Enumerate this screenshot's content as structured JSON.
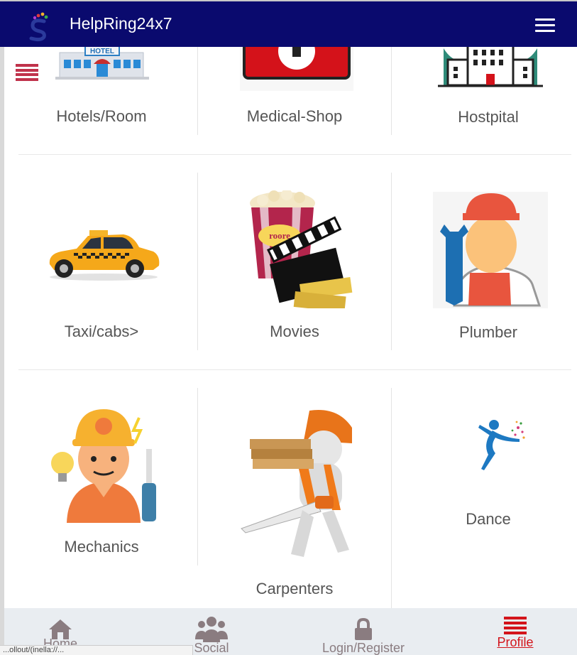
{
  "header": {
    "title": "HelpRing24x7",
    "logo_icon": "colorful-s-logo-icon",
    "menu_icon": "hamburger-icon"
  },
  "side_menu_icon": "list-menu-icon",
  "colors": {
    "header_bg": "#0a0a6e",
    "accent_red": "#d3141b",
    "side_menu": "#c0324b",
    "nav_bg": "#e9edf1"
  },
  "tiles": [
    {
      "label": "Hotels/Room",
      "icon": "hotel-building-icon"
    },
    {
      "label": "Medical-Shop",
      "icon": "medical-sign-icon"
    },
    {
      "label": "Hostpital",
      "icon": "hospital-building-icon"
    },
    {
      "label": "Taxi/cabs>",
      "icon": "taxi-car-icon"
    },
    {
      "label": "Movies",
      "icon": "popcorn-clapperboard-icon"
    },
    {
      "label": "Plumber",
      "icon": "plumber-wrench-icon"
    },
    {
      "label": "Mechanics",
      "icon": "mechanic-worker-icon"
    },
    {
      "label": "Carpenters",
      "icon": "carpenter-saw-icon"
    },
    {
      "label": "Dance",
      "icon": "dancer-icon"
    }
  ],
  "bottom_nav": [
    {
      "label": "Home",
      "icon": "home-icon",
      "active": false
    },
    {
      "label": "Social",
      "icon": "users-group-icon",
      "active": false
    },
    {
      "label": "Login/Register",
      "icon": "lock-icon",
      "active": false
    },
    {
      "label": "Profile",
      "icon": "list-menu-icon",
      "active": true
    }
  ],
  "status_bar_text": "...ollout/(inella://..."
}
